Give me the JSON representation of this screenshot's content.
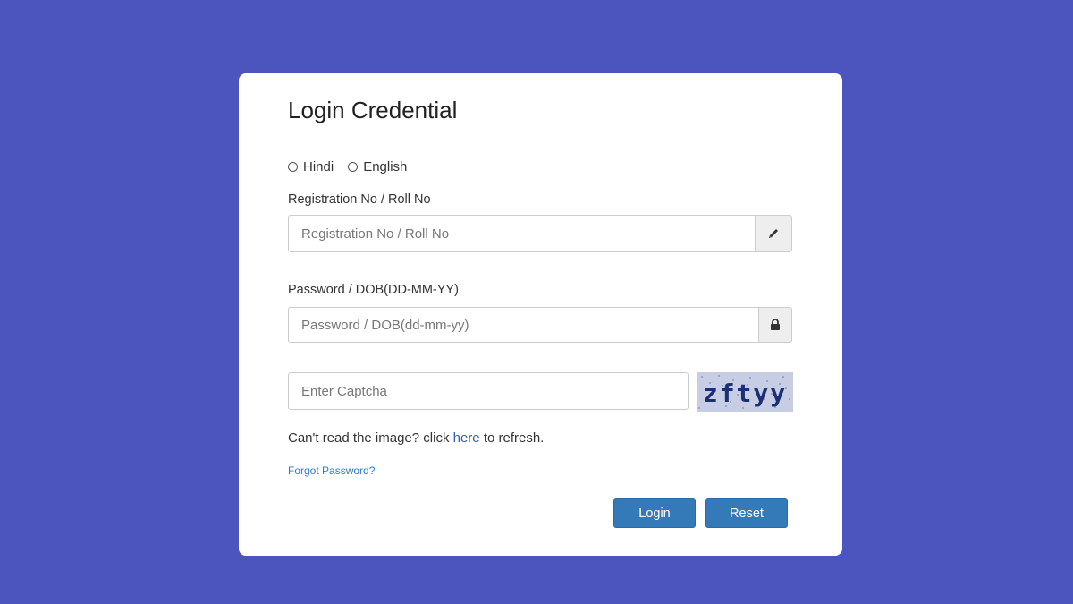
{
  "form": {
    "title": "Login Credential",
    "languages": [
      {
        "label": "Hindi",
        "selected": false
      },
      {
        "label": "English",
        "selected": false
      }
    ],
    "registration": {
      "label": "Registration No / Roll No",
      "placeholder": "Registration No / Roll No",
      "value": "",
      "icon": "pencil-icon"
    },
    "password": {
      "label": "Password / DOB(DD-MM-YY)",
      "placeholder": "Password / DOB(dd-mm-yy)",
      "value": "",
      "icon": "lock-icon"
    },
    "captcha": {
      "placeholder": "Enter Captcha",
      "value": "",
      "image_text": "zftyy"
    },
    "refresh": {
      "before": "Can't read the image? click ",
      "link": "here",
      "after": " to refresh."
    },
    "forgot_password": "Forgot Password?",
    "login_label": "Login",
    "reset_label": "Reset"
  },
  "colors": {
    "background": "#4c55be",
    "card": "#ffffff",
    "button": "#357ab8",
    "link": "#2f5db4",
    "forgot_link": "#2a7bd8"
  }
}
